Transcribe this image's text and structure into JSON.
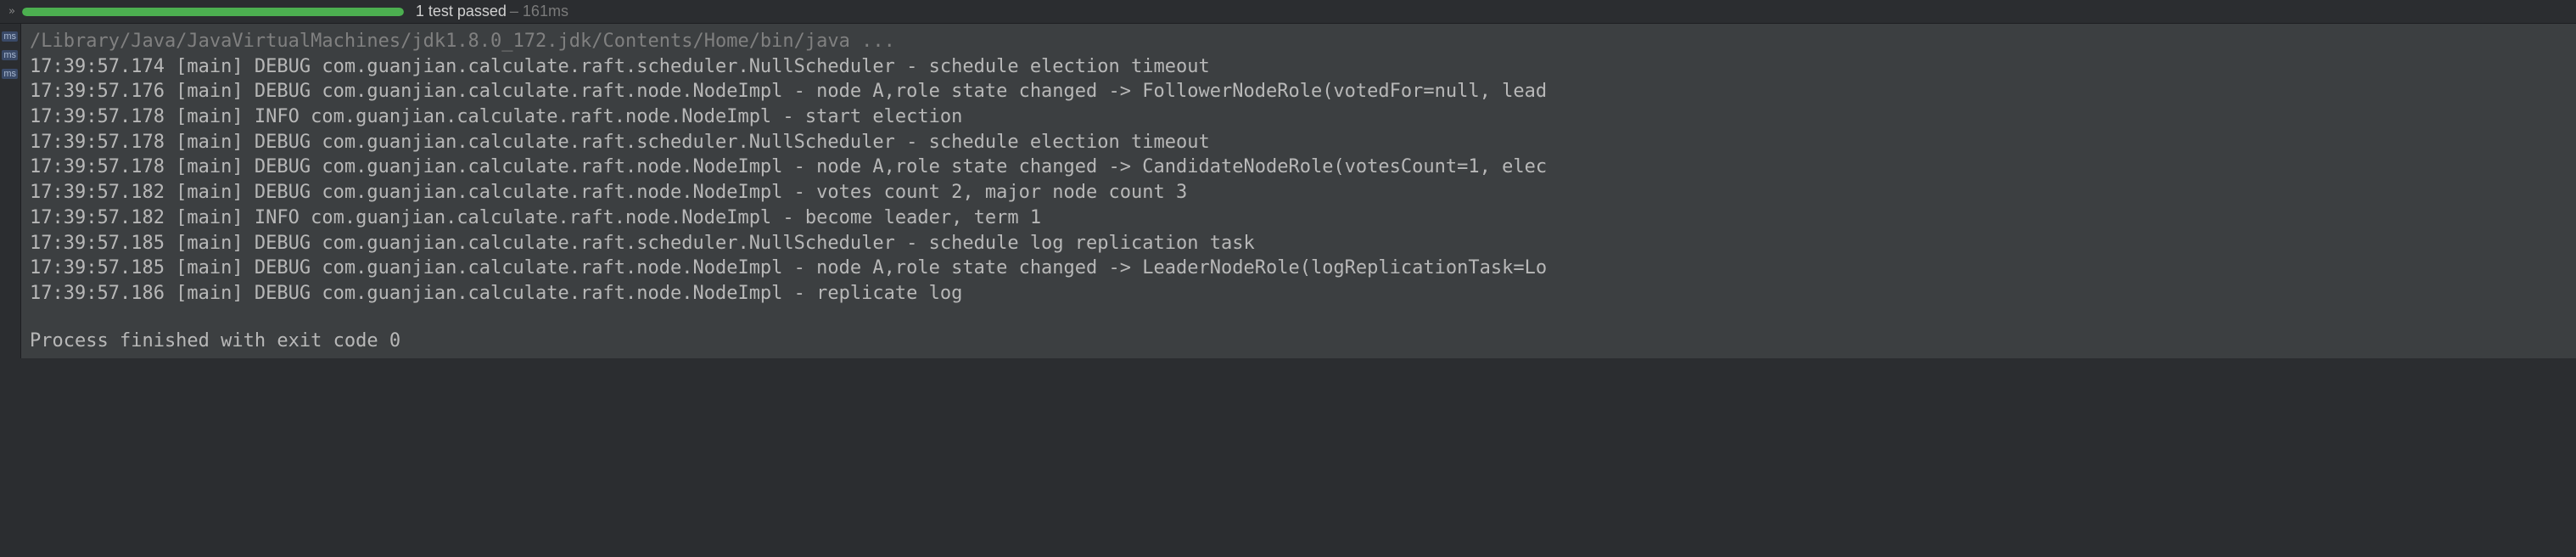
{
  "header": {
    "progress_percent": 100,
    "test_status": "1 test passed",
    "test_time": "– 161ms"
  },
  "gutter": {
    "badges": [
      "ms",
      "ms",
      "ms"
    ]
  },
  "console": {
    "command": "/Library/Java/JavaVirtualMachines/jdk1.8.0_172.jdk/Contents/Home/bin/java ...",
    "logs": [
      "17:39:57.174 [main] DEBUG com.guanjian.calculate.raft.scheduler.NullScheduler - schedule election timeout",
      "17:39:57.176 [main] DEBUG com.guanjian.calculate.raft.node.NodeImpl - node A,role state changed -> FollowerNodeRole(votedFor=null, lead",
      "17:39:57.178 [main] INFO com.guanjian.calculate.raft.node.NodeImpl - start election",
      "17:39:57.178 [main] DEBUG com.guanjian.calculate.raft.scheduler.NullScheduler - schedule election timeout",
      "17:39:57.178 [main] DEBUG com.guanjian.calculate.raft.node.NodeImpl - node A,role state changed -> CandidateNodeRole(votesCount=1, elec",
      "17:39:57.182 [main] DEBUG com.guanjian.calculate.raft.node.NodeImpl - votes count 2, major node count 3",
      "17:39:57.182 [main] INFO com.guanjian.calculate.raft.node.NodeImpl - become leader, term 1",
      "17:39:57.185 [main] DEBUG com.guanjian.calculate.raft.scheduler.NullScheduler - schedule log replication task",
      "17:39:57.185 [main] DEBUG com.guanjian.calculate.raft.node.NodeImpl - node A,role state changed -> LeaderNodeRole(logReplicationTask=Lo",
      "17:39:57.186 [main] DEBUG com.guanjian.calculate.raft.node.NodeImpl - replicate log"
    ],
    "finish": "Process finished with exit code 0"
  }
}
